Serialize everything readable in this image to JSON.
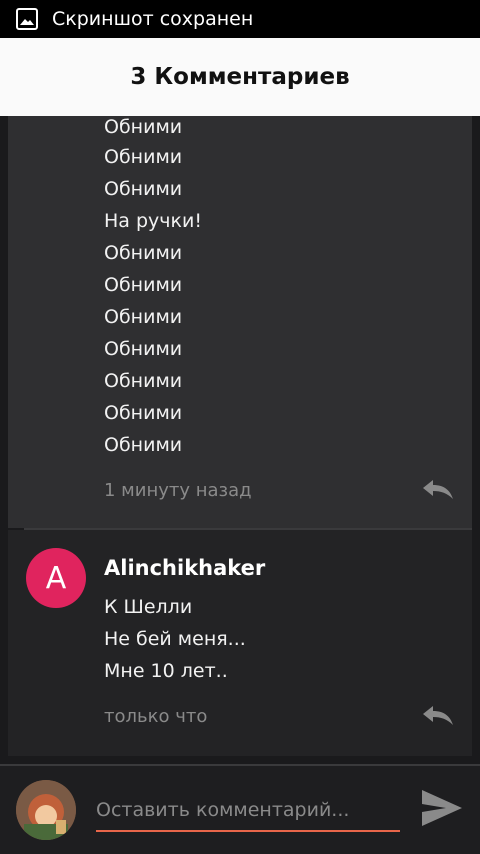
{
  "status_bar": {
    "notification_text": "Скриншот сохранен",
    "icon": "image-icon"
  },
  "header": {
    "title": "3 Комментариев"
  },
  "comments": [
    {
      "lines": [
        "Обними",
        "Обними",
        "Обними",
        "На ручки!",
        "Обними",
        "Обними",
        "Обними",
        "Обними",
        "Обними",
        "Обними",
        "Обними"
      ],
      "time": "1 минуту назад",
      "reply_icon": "reply-icon"
    },
    {
      "avatar_letter": "A",
      "avatar_color": "#e0245e",
      "username": "Alinchikhaker",
      "lines": [
        "К Шелли",
        "Не бей меня...",
        "Мне 10 лет.."
      ],
      "time": "только что",
      "reply_icon": "reply-icon"
    }
  ],
  "composer": {
    "placeholder": "Оставить комментарий...",
    "value": "",
    "accent_color": "#e8664a",
    "send_icon": "send-icon"
  }
}
